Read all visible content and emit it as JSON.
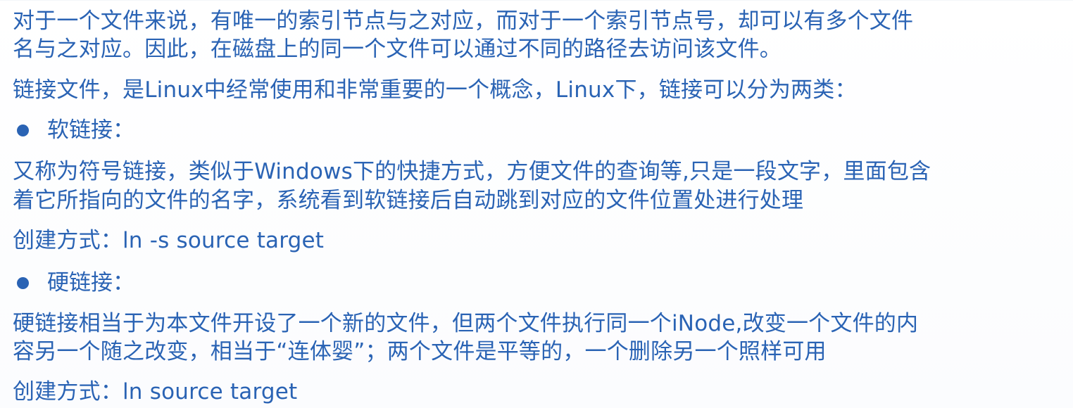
{
  "content": {
    "para1_line1": "对于一个文件来说，有唯一的索引节点与之对应，而对于一个索引节点号，却可以有多个文件",
    "para1_line2": "名与之对应。因此，在磁盘上的同一个文件可以通过不同的路径去访问该文件。",
    "para2": "链接文件，是Linux中经常使用和非常重要的一个概念，Linux下，链接可以分为两类：",
    "soft_heading": "软链接：",
    "soft_desc_line1": "又称为符号链接，类似于Windows下的快捷方式，方便文件的查询等,只是一段文字，里面包含",
    "soft_desc_line2": "着它所指向的文件的名字，系统看到软链接后自动跳到对应的文件位置处进行处理",
    "soft_create": "创建方式：ln -s source target",
    "hard_heading": "硬链接：",
    "hard_desc_line1": "硬链接相当于为本文件开设了一个新的文件，但两个文件执行同一个iNode,改变一个文件的内",
    "hard_desc_line2": "容另一个随之改变，相当于“连体婴”；两个文件是平等的，一个删除另一个照样可用",
    "hard_create": "创建方式：ln source target"
  },
  "colors": {
    "text": "#2a63b4",
    "background": "#ffffff"
  },
  "icons": {
    "bullet": "filled-circle-bullet-icon"
  }
}
